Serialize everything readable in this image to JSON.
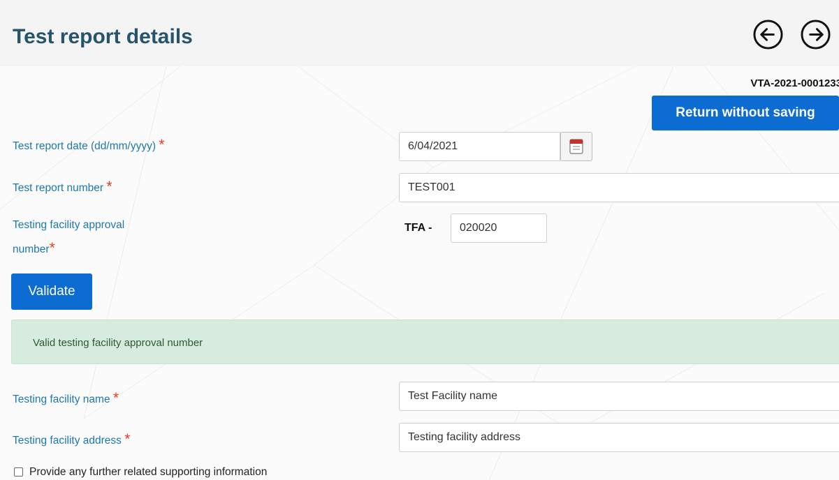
{
  "page": {
    "title": "Test report details",
    "reference": "VTA-2021-0001233"
  },
  "nav": {
    "prev_icon": "arrow-left-circle-icon",
    "next_icon": "arrow-right-circle-icon"
  },
  "actions": {
    "return_label": "Return without saving",
    "validate_label": "Validate"
  },
  "form": {
    "report_date": {
      "label": "Test report date (dd/mm/yyyy)",
      "required": "*",
      "value": "6/04/2021",
      "icon": "calendar-icon"
    },
    "report_number": {
      "label": "Test report number",
      "required": "*",
      "value": "TEST001"
    },
    "approval_number": {
      "label_line1": "Testing facility approval",
      "label_line2": "number",
      "required": "*",
      "prefix": "TFA -",
      "value": "020020"
    },
    "facility_name": {
      "label": "Testing facility name",
      "required": "*",
      "value": "Test Facility name"
    },
    "facility_address": {
      "label": "Testing facility address",
      "required": "*",
      "value": "Testing facility address"
    }
  },
  "alert": {
    "message": "Valid testing facility approval number"
  },
  "supporting_info": {
    "label": "Provide any further related supporting information",
    "checked": false
  },
  "colors": {
    "title": "#25546b",
    "label": "#1e77b0",
    "required": "#e63a1f",
    "primary": "#0d6cd1",
    "success_bg": "#d7ecdf"
  }
}
